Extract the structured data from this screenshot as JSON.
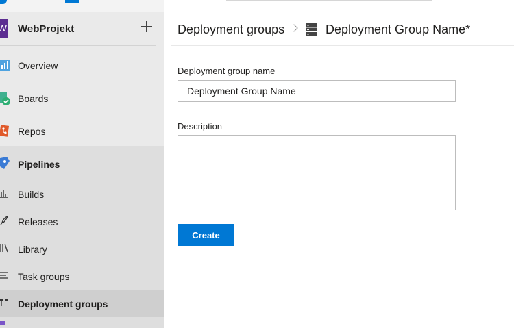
{
  "project": {
    "initial": "W",
    "name": "WebProjekt"
  },
  "sidebar": {
    "items": [
      {
        "label": "Overview",
        "icon": "overview-icon"
      },
      {
        "label": "Boards",
        "icon": "boards-icon"
      },
      {
        "label": "Repos",
        "icon": "repos-icon"
      },
      {
        "label": "Pipelines",
        "icon": "pipelines-icon"
      },
      {
        "label": "Builds",
        "icon": "builds-icon"
      },
      {
        "label": "Releases",
        "icon": "releases-icon"
      },
      {
        "label": "Library",
        "icon": "library-icon"
      },
      {
        "label": "Task groups",
        "icon": "task-groups-icon"
      },
      {
        "label": "Deployment groups",
        "icon": "deployment-groups-icon",
        "selected": true
      }
    ]
  },
  "breadcrumb": {
    "parent": "Deployment groups",
    "current": "Deployment Group Name*"
  },
  "form": {
    "name_label": "Deployment group name",
    "name_value": "Deployment Group Name",
    "description_label": "Description",
    "description_value": "",
    "create_label": "Create"
  },
  "colors": {
    "accent": "#0078d4",
    "project": "#5c2d91",
    "sidebar_bg": "#eaeaea",
    "selected_bg": "#cfcfcf"
  }
}
